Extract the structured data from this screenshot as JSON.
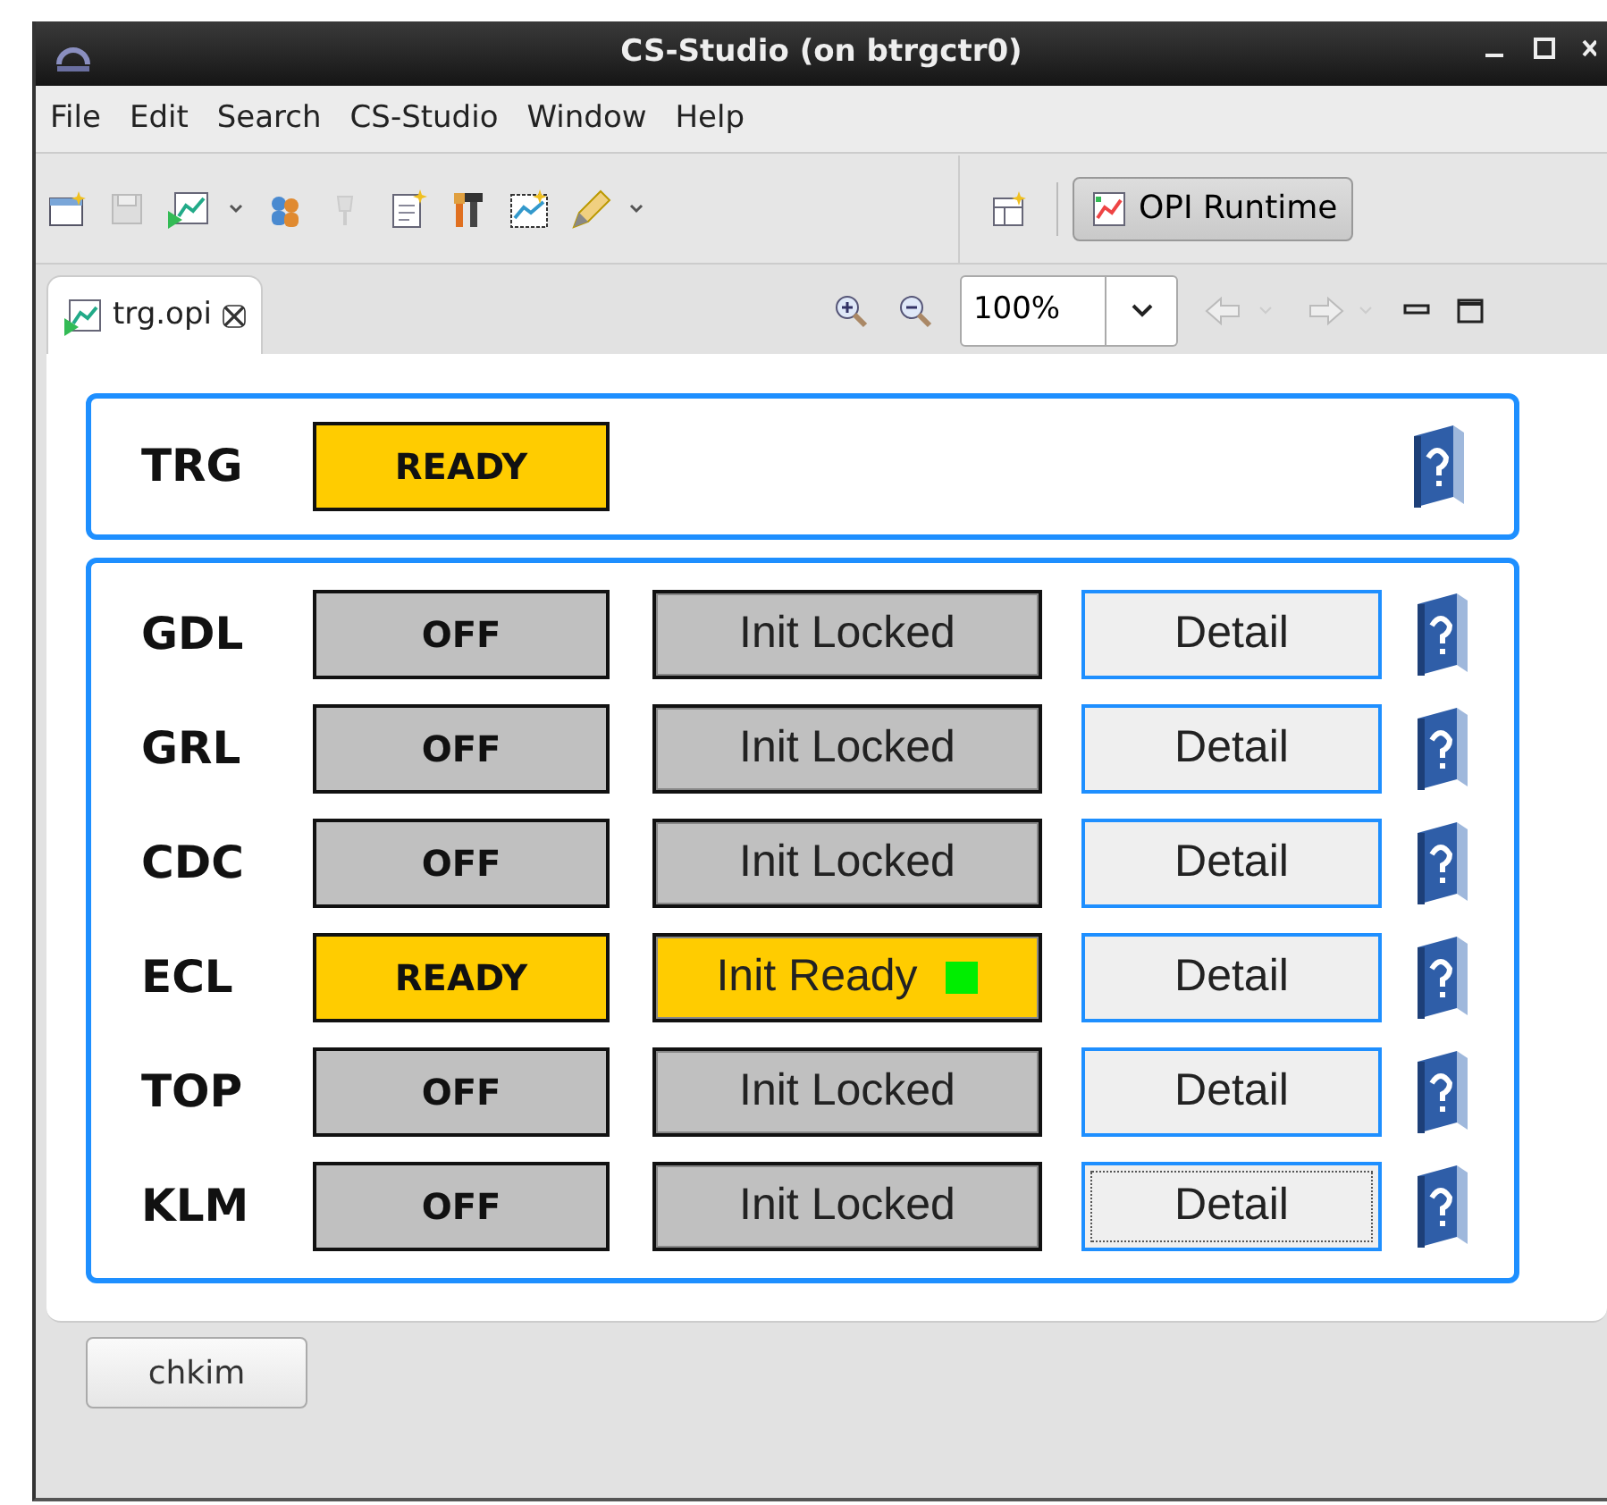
{
  "window": {
    "title": "CS-Studio  (on btrgctr0)"
  },
  "menu": [
    "File",
    "Edit",
    "Search",
    "CS-Studio",
    "Window",
    "Help"
  ],
  "perspective": {
    "label": "OPI Runtime",
    "selected": true
  },
  "editor_tab": {
    "label": "trg.opi",
    "selected": true
  },
  "zoom": {
    "value": "100%"
  },
  "trigger": {
    "name": "TRG",
    "status": {
      "text": "READY",
      "kind": "ready"
    }
  },
  "subsystems": [
    {
      "name": "GDL",
      "status": {
        "text": "OFF",
        "kind": "off"
      },
      "init": {
        "text": "Init Locked",
        "kind": "off",
        "led_on": false
      },
      "detail": {
        "label": "Detail",
        "focused": false
      }
    },
    {
      "name": "GRL",
      "status": {
        "text": "OFF",
        "kind": "off"
      },
      "init": {
        "text": "Init Locked",
        "kind": "off",
        "led_on": false
      },
      "detail": {
        "label": "Detail",
        "focused": false
      }
    },
    {
      "name": "CDC",
      "status": {
        "text": "OFF",
        "kind": "off"
      },
      "init": {
        "text": "Init Locked",
        "kind": "off",
        "led_on": false
      },
      "detail": {
        "label": "Detail",
        "focused": false
      }
    },
    {
      "name": "ECL",
      "status": {
        "text": "READY",
        "kind": "ready"
      },
      "init": {
        "text": "Init Ready",
        "kind": "ready",
        "led_on": true
      },
      "detail": {
        "label": "Detail",
        "focused": false
      }
    },
    {
      "name": "TOP",
      "status": {
        "text": "OFF",
        "kind": "off"
      },
      "init": {
        "text": "Init Locked",
        "kind": "off",
        "led_on": false
      },
      "detail": {
        "label": "Detail",
        "focused": false
      }
    },
    {
      "name": "KLM",
      "status": {
        "text": "OFF",
        "kind": "off"
      },
      "init": {
        "text": "Init Locked",
        "kind": "off",
        "led_on": false
      },
      "detail": {
        "label": "Detail",
        "focused": true
      }
    }
  ],
  "status_bar": {
    "user": "chkim"
  }
}
